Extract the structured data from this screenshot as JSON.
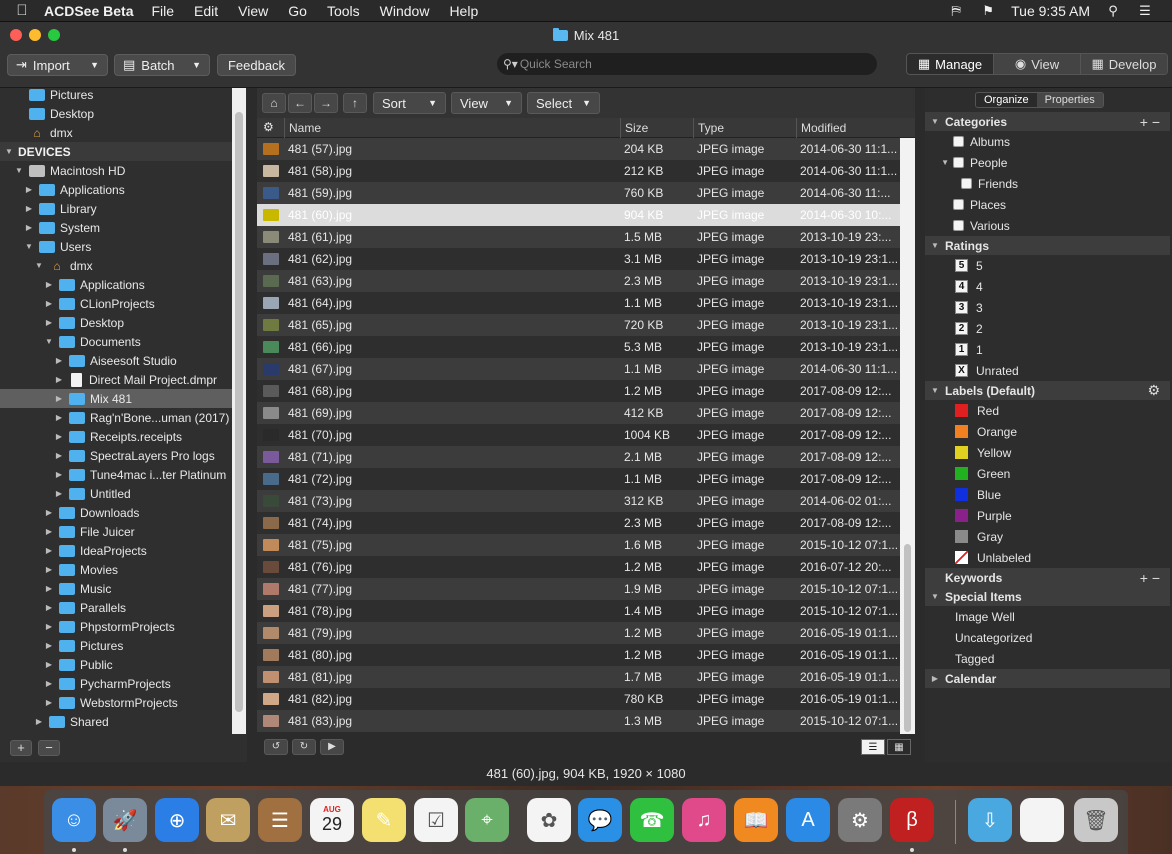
{
  "menubar": {
    "app_name": "ACDSee Beta",
    "items": [
      "File",
      "Edit",
      "View",
      "Go",
      "Tools",
      "Window",
      "Help"
    ],
    "clock": "Tue 9:35 AM"
  },
  "window": {
    "title": "Mix 481"
  },
  "toolbar": {
    "import_label": "Import",
    "batch_label": "Batch",
    "feedback_label": "Feedback",
    "search_placeholder": "Quick Search",
    "modes": [
      {
        "label": "Manage",
        "active": true
      },
      {
        "label": "View",
        "active": false
      },
      {
        "label": "Develop",
        "active": false
      }
    ]
  },
  "sidebar": {
    "rows": [
      {
        "label": "Pictures",
        "indent": 1,
        "icon": "folder",
        "disc": ""
      },
      {
        "label": "Desktop",
        "indent": 1,
        "icon": "folder",
        "disc": ""
      },
      {
        "label": "dmx",
        "indent": 1,
        "icon": "home",
        "disc": ""
      },
      {
        "label": "DEVICES",
        "indent": 0,
        "icon": "",
        "disc": "▼",
        "header": true
      },
      {
        "label": "Macintosh HD",
        "indent": 1,
        "icon": "disk",
        "disc": "▼"
      },
      {
        "label": "Applications",
        "indent": 2,
        "icon": "folder",
        "disc": "▶"
      },
      {
        "label": "Library",
        "indent": 2,
        "icon": "folder",
        "disc": "▶"
      },
      {
        "label": "System",
        "indent": 2,
        "icon": "folder",
        "disc": "▶"
      },
      {
        "label": "Users",
        "indent": 2,
        "icon": "folder",
        "disc": "▼"
      },
      {
        "label": "dmx",
        "indent": 3,
        "icon": "home",
        "disc": "▼"
      },
      {
        "label": "Applications",
        "indent": 4,
        "icon": "folder",
        "disc": "▶"
      },
      {
        "label": "CLionProjects",
        "indent": 4,
        "icon": "folder",
        "disc": "▶"
      },
      {
        "label": "Desktop",
        "indent": 4,
        "icon": "folder",
        "disc": "▶"
      },
      {
        "label": "Documents",
        "indent": 4,
        "icon": "folder",
        "disc": "▼"
      },
      {
        "label": "Aiseesoft Studio",
        "indent": 5,
        "icon": "folder",
        "disc": "▶"
      },
      {
        "label": "Direct Mail Project.dmpr",
        "indent": 5,
        "icon": "doc",
        "disc": "▶"
      },
      {
        "label": "Mix 481",
        "indent": 5,
        "icon": "folder",
        "disc": "▶",
        "selected": true
      },
      {
        "label": "Rag'n'Bone...uman (2017)",
        "indent": 5,
        "icon": "folder",
        "disc": "▶"
      },
      {
        "label": "Receipts.receipts",
        "indent": 5,
        "icon": "folder",
        "disc": "▶"
      },
      {
        "label": "SpectraLayers Pro logs",
        "indent": 5,
        "icon": "folder",
        "disc": "▶"
      },
      {
        "label": "Tune4mac i...ter Platinum",
        "indent": 5,
        "icon": "folder",
        "disc": "▶"
      },
      {
        "label": "Untitled",
        "indent": 5,
        "icon": "folder",
        "disc": "▶"
      },
      {
        "label": "Downloads",
        "indent": 4,
        "icon": "folder",
        "disc": "▶"
      },
      {
        "label": "File Juicer",
        "indent": 4,
        "icon": "folder",
        "disc": "▶"
      },
      {
        "label": "IdeaProjects",
        "indent": 4,
        "icon": "folder",
        "disc": "▶"
      },
      {
        "label": "Movies",
        "indent": 4,
        "icon": "folder",
        "disc": "▶"
      },
      {
        "label": "Music",
        "indent": 4,
        "icon": "folder",
        "disc": "▶"
      },
      {
        "label": "Parallels",
        "indent": 4,
        "icon": "folder",
        "disc": "▶"
      },
      {
        "label": "PhpstormProjects",
        "indent": 4,
        "icon": "folder",
        "disc": "▶"
      },
      {
        "label": "Pictures",
        "indent": 4,
        "icon": "folder",
        "disc": "▶"
      },
      {
        "label": "Public",
        "indent": 4,
        "icon": "folder",
        "disc": "▶"
      },
      {
        "label": "PycharmProjects",
        "indent": 4,
        "icon": "folder",
        "disc": "▶"
      },
      {
        "label": "WebstormProjects",
        "indent": 4,
        "icon": "folder",
        "disc": "▶"
      },
      {
        "label": "Shared",
        "indent": 3,
        "icon": "folder",
        "disc": "▶"
      }
    ],
    "add_label": "+",
    "remove_label": "−"
  },
  "nav": {
    "sort_label": "Sort",
    "view_label": "View",
    "select_label": "Select"
  },
  "columns": {
    "name": "Name",
    "size": "Size",
    "type": "Type",
    "modified": "Modified"
  },
  "files": [
    {
      "name": "481 (57).jpg",
      "size": "204 KB",
      "type": "JPEG image",
      "modified": "2014-06-30 11:1...",
      "thumb": "#b4701e"
    },
    {
      "name": "481 (58).jpg",
      "size": "212 KB",
      "type": "JPEG image",
      "modified": "2014-06-30 11:1...",
      "thumb": "#c9b8a0"
    },
    {
      "name": "481 (59).jpg",
      "size": "760 KB",
      "type": "JPEG image",
      "modified": "2014-06-30 11:...",
      "thumb": "#3a5a8a"
    },
    {
      "name": "481 (60).jpg",
      "size": "904 KB",
      "type": "JPEG image",
      "modified": "2014-06-30 10:...",
      "thumb": "#c8b800",
      "selected": true
    },
    {
      "name": "481 (61).jpg",
      "size": "1.5 MB",
      "type": "JPEG image",
      "modified": "2013-10-19 23:...",
      "thumb": "#8a8a78"
    },
    {
      "name": "481 (62).jpg",
      "size": "3.1 MB",
      "type": "JPEG image",
      "modified": "2013-10-19 23:1...",
      "thumb": "#6a7080"
    },
    {
      "name": "481 (63).jpg",
      "size": "2.3 MB",
      "type": "JPEG image",
      "modified": "2013-10-19 23:1...",
      "thumb": "#5a6a50"
    },
    {
      "name": "481 (64).jpg",
      "size": "1.1 MB",
      "type": "JPEG image",
      "modified": "2013-10-19 23:1...",
      "thumb": "#9aa6b4"
    },
    {
      "name": "481 (65).jpg",
      "size": "720 KB",
      "type": "JPEG image",
      "modified": "2013-10-19 23:1...",
      "thumb": "#6e7a40"
    },
    {
      "name": "481 (66).jpg",
      "size": "5.3 MB",
      "type": "JPEG image",
      "modified": "2013-10-19 23:1...",
      "thumb": "#4a8a5a"
    },
    {
      "name": "481 (67).jpg",
      "size": "1.1 MB",
      "type": "JPEG image",
      "modified": "2014-06-30 11:1...",
      "thumb": "#2a3a6a"
    },
    {
      "name": "481 (68).jpg",
      "size": "1.2 MB",
      "type": "JPEG image",
      "modified": "2017-08-09 12:...",
      "thumb": "#5a5a5a"
    },
    {
      "name": "481 (69).jpg",
      "size": "412 KB",
      "type": "JPEG image",
      "modified": "2017-08-09 12:...",
      "thumb": "#8a8a8a"
    },
    {
      "name": "481 (70).jpg",
      "size": "1004 KB",
      "type": "JPEG image",
      "modified": "2017-08-09 12:...",
      "thumb": "#2a2a2a"
    },
    {
      "name": "481 (71).jpg",
      "size": "2.1 MB",
      "type": "JPEG image",
      "modified": "2017-08-09 12:...",
      "thumb": "#7a5a9a"
    },
    {
      "name": "481 (72).jpg",
      "size": "1.1 MB",
      "type": "JPEG image",
      "modified": "2017-08-09 12:...",
      "thumb": "#4a6a8a"
    },
    {
      "name": "481 (73).jpg",
      "size": "312 KB",
      "type": "JPEG image",
      "modified": "2014-06-02 01:...",
      "thumb": "#3a4a3a"
    },
    {
      "name": "481 (74).jpg",
      "size": "2.3 MB",
      "type": "JPEG image",
      "modified": "2017-08-09 12:...",
      "thumb": "#8a6a4a"
    },
    {
      "name": "481 (75).jpg",
      "size": "1.6 MB",
      "type": "JPEG image",
      "modified": "2015-10-12 07:1...",
      "thumb": "#c08a5a"
    },
    {
      "name": "481 (76).jpg",
      "size": "1.2 MB",
      "type": "JPEG image",
      "modified": "2016-07-12 20:...",
      "thumb": "#6a4a3a"
    },
    {
      "name": "481 (77).jpg",
      "size": "1.9 MB",
      "type": "JPEG image",
      "modified": "2015-10-12 07:1...",
      "thumb": "#b07a6a"
    },
    {
      "name": "481 (78).jpg",
      "size": "1.4 MB",
      "type": "JPEG image",
      "modified": "2015-10-12 07:1...",
      "thumb": "#caa080"
    },
    {
      "name": "481 (79).jpg",
      "size": "1.2 MB",
      "type": "JPEG image",
      "modified": "2016-05-19 01:1...",
      "thumb": "#b08a6a"
    },
    {
      "name": "481 (80).jpg",
      "size": "1.2 MB",
      "type": "JPEG image",
      "modified": "2016-05-19 01:1...",
      "thumb": "#a07a5a"
    },
    {
      "name": "481 (81).jpg",
      "size": "1.7 MB",
      "type": "JPEG image",
      "modified": "2016-05-19 01:1...",
      "thumb": "#c09070"
    },
    {
      "name": "481 (82).jpg",
      "size": "780 KB",
      "type": "JPEG image",
      "modified": "2016-05-19 01:1...",
      "thumb": "#d0a888"
    },
    {
      "name": "481 (83).jpg",
      "size": "1.3 MB",
      "type": "JPEG image",
      "modified": "2015-10-12 07:1...",
      "thumb": "#b08878"
    }
  ],
  "right_panel": {
    "tabs": [
      {
        "label": "Organize",
        "active": true
      },
      {
        "label": "Properties",
        "active": false
      }
    ],
    "rows": [
      {
        "kind": "section",
        "label": "Categories",
        "disc": "▼",
        "actions": "+ −"
      },
      {
        "kind": "check",
        "label": "Albums",
        "indent": 1,
        "disc": ""
      },
      {
        "kind": "check",
        "label": "People",
        "indent": 1,
        "disc": "▼"
      },
      {
        "kind": "check",
        "label": "Friends",
        "indent": 2,
        "disc": ""
      },
      {
        "kind": "check",
        "label": "Places",
        "indent": 1,
        "disc": ""
      },
      {
        "kind": "check",
        "label": "Various",
        "indent": 1,
        "disc": ""
      },
      {
        "kind": "section",
        "label": "Ratings",
        "disc": "▼",
        "actions": ""
      },
      {
        "kind": "rating",
        "label": "5",
        "box": "5"
      },
      {
        "kind": "rating",
        "label": "4",
        "box": "4"
      },
      {
        "kind": "rating",
        "label": "3",
        "box": "3"
      },
      {
        "kind": "rating",
        "label": "2",
        "box": "2"
      },
      {
        "kind": "rating",
        "label": "1",
        "box": "1"
      },
      {
        "kind": "rating",
        "label": "Unrated",
        "box": "X"
      },
      {
        "kind": "section",
        "label": "Labels (Default)",
        "disc": "▼",
        "actions": "⚙"
      },
      {
        "kind": "label",
        "label": "Red",
        "color": "#e02020"
      },
      {
        "kind": "label",
        "label": "Orange",
        "color": "#f08020"
      },
      {
        "kind": "label",
        "label": "Yellow",
        "color": "#e0d020"
      },
      {
        "kind": "label",
        "label": "Green",
        "color": "#20b020"
      },
      {
        "kind": "label",
        "label": "Blue",
        "color": "#1030e0"
      },
      {
        "kind": "label",
        "label": "Purple",
        "color": "#8a208a"
      },
      {
        "kind": "label",
        "label": "Gray",
        "color": "#8a8a8a"
      },
      {
        "kind": "label",
        "label": "Unlabeled",
        "color": "none"
      },
      {
        "kind": "section",
        "label": "Keywords",
        "disc": "",
        "actions": "+ −"
      },
      {
        "kind": "section",
        "label": "Special Items",
        "disc": "▼",
        "actions": ""
      },
      {
        "kind": "plain",
        "label": "Image Well"
      },
      {
        "kind": "plain",
        "label": "Uncategorized"
      },
      {
        "kind": "plain",
        "label": "Tagged"
      },
      {
        "kind": "section",
        "label": "Calendar",
        "disc": "▶",
        "actions": ""
      }
    ]
  },
  "status": {
    "text": "481 (60).jpg, 904 KB, 1920 × 1080"
  },
  "dock": {
    "calendar_month": "AUG",
    "calendar_day": "29",
    "apps": [
      {
        "name": "finder",
        "color": "#3a8ee6",
        "glyph": "☺"
      },
      {
        "name": "launchpad",
        "color": "#7a8a9a",
        "glyph": "🚀"
      },
      {
        "name": "safari",
        "color": "#2a7ee6",
        "glyph": "⊕"
      },
      {
        "name": "mail",
        "color": "#c0a060",
        "glyph": "✉"
      },
      {
        "name": "contacts",
        "color": "#a07040",
        "glyph": "☰"
      },
      {
        "name": "calendar",
        "color": "#f4f4f4",
        "glyph": ""
      },
      {
        "name": "notes",
        "color": "#f4e070",
        "glyph": "✎"
      },
      {
        "name": "reminders",
        "color": "#f4f4f4",
        "glyph": "☑"
      },
      {
        "name": "maps",
        "color": "#6ab06a",
        "glyph": "⌖"
      },
      {
        "name": "photos",
        "color": "#f4f4f4",
        "glyph": "✿"
      },
      {
        "name": "messages",
        "color": "#2a90e6",
        "glyph": "💬"
      },
      {
        "name": "facetime",
        "color": "#30c040",
        "glyph": "☎"
      },
      {
        "name": "itunes",
        "color": "#e04a8a",
        "glyph": "♫"
      },
      {
        "name": "ibooks",
        "color": "#f08a20",
        "glyph": "📖"
      },
      {
        "name": "app-store",
        "color": "#2a8ae6",
        "glyph": "A"
      },
      {
        "name": "system-preferences",
        "color": "#7a7a7a",
        "glyph": "⚙"
      },
      {
        "name": "acdsee",
        "color": "#c02020",
        "glyph": "β"
      },
      {
        "name": "downloads",
        "color": "#4aa8e0",
        "glyph": "⇩"
      },
      {
        "name": "preview",
        "color": "#f4f4f4",
        "glyph": ""
      },
      {
        "name": "trash",
        "color": "#c8c8c8",
        "glyph": "🗑"
      }
    ]
  }
}
